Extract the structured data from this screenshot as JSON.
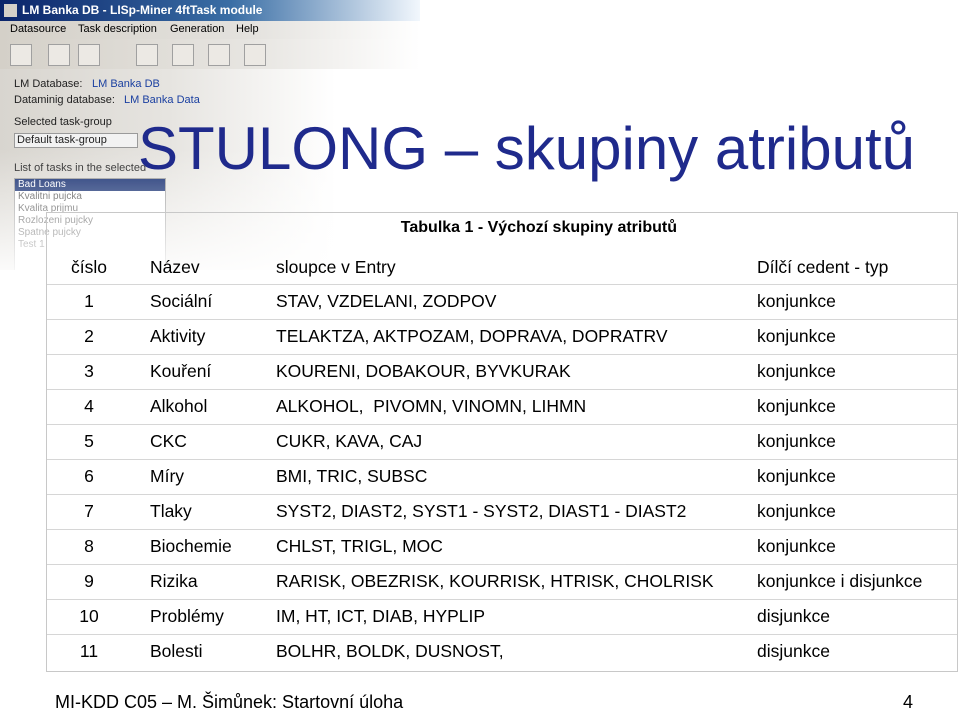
{
  "bg_app": {
    "window_title": "LM Banka DB - LISp-Miner 4ftTask module",
    "menu": [
      "Datasource",
      "Task description",
      "Generation",
      "Help"
    ],
    "lm_database_label": "LM Database:",
    "lm_database_value": "LM Banka DB",
    "datamining_label": "Dataminig database:",
    "datamining_value": "LM Banka Data",
    "task_group_label": "Selected task-group",
    "task_group_value": "Default task-group",
    "tasks_label": "List of tasks in the selected",
    "tasks": [
      "Bad Loans",
      "Kvalitni pujcka",
      "Kvalita prijmu",
      "Rozlozeni pujcky",
      "Spatne pujcky",
      "Test 1"
    ]
  },
  "title": "STULONG – skupiny atributů",
  "table": {
    "caption": "Tabulka 1 - Výchozí skupiny atributů",
    "headers": [
      "číslo",
      "Název",
      "sloupce v Entry",
      "Dílčí cedent - typ"
    ],
    "rows": [
      [
        "1",
        "Sociální",
        "STAV, VZDELANI, ZODPOV",
        "konjunkce"
      ],
      [
        "2",
        "Aktivity",
        "TELAKTZA, AKTPOZAM, DOPRAVA, DOPRATRV",
        "konjunkce"
      ],
      [
        "3",
        "Kouření",
        "KOURENI, DOBAKOUR, BYVKURAK",
        "konjunkce"
      ],
      [
        "4",
        "Alkohol",
        "ALKOHOL,  PIVOMN, VINOMN, LIHMN",
        "konjunkce"
      ],
      [
        "5",
        "CKC",
        "CUKR, KAVA, CAJ",
        "konjunkce"
      ],
      [
        "6",
        "Míry",
        "BMI, TRIC, SUBSC",
        "konjunkce"
      ],
      [
        "7",
        "Tlaky",
        "SYST2, DIAST2, SYST1 - SYST2, DIAST1 - DIAST2",
        "konjunkce"
      ],
      [
        "8",
        "Biochemie",
        "CHLST, TRIGL, MOC",
        "konjunkce"
      ],
      [
        "9",
        "Rizika",
        "RARISK, OBEZRISK, KOURRISK, HTRISK, CHOLRISK",
        "konjunkce i disjunkce"
      ],
      [
        "10",
        "Problémy",
        "IM, HT, ICT, DIAB, HYPLIP",
        "disjunkce"
      ],
      [
        "11",
        "Bolesti",
        "BOLHR, BOLDK, DUSNOST,",
        "disjunkce"
      ]
    ]
  },
  "footer": {
    "left": "MI-KDD C05 – M. Šimůnek: Startovní úloha",
    "page": "4"
  }
}
